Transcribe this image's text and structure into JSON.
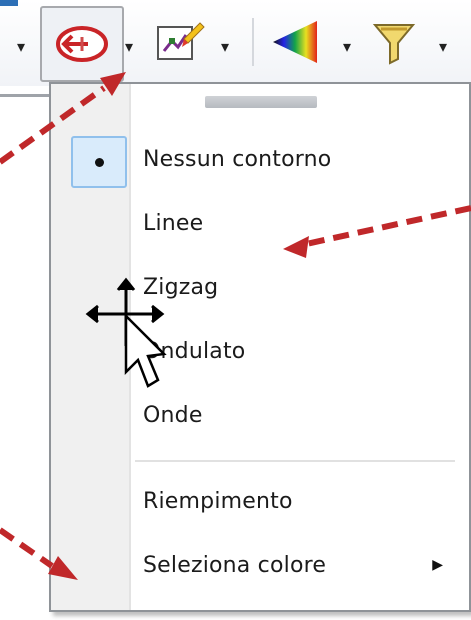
{
  "toolbar": {
    "buttons": [
      {
        "name": "outline-style",
        "icon": "outline-arrow-icon"
      },
      {
        "name": "edit-points",
        "icon": "edit-points-icon"
      },
      {
        "name": "fill-color",
        "icon": "color-triangle-icon"
      },
      {
        "name": "filter",
        "icon": "funnel-icon"
      }
    ]
  },
  "menu": {
    "items": [
      {
        "label": "Nessun contorno",
        "checked": true
      },
      {
        "label": "Linee"
      },
      {
        "label": "Zigzag"
      },
      {
        "label": "Ondulato"
      },
      {
        "label": "Onde"
      }
    ],
    "fill_items": [
      {
        "label": "Riempimento"
      },
      {
        "label": "Seleziona colore",
        "has_submenu": true
      }
    ]
  },
  "annotations": {
    "arrow_color": "#c0282a"
  },
  "colors": {
    "menu_border": "#8f9398",
    "gutter": "#f0f0f0",
    "selection": "#d9ebfb",
    "accent": "#2d6fb6"
  }
}
